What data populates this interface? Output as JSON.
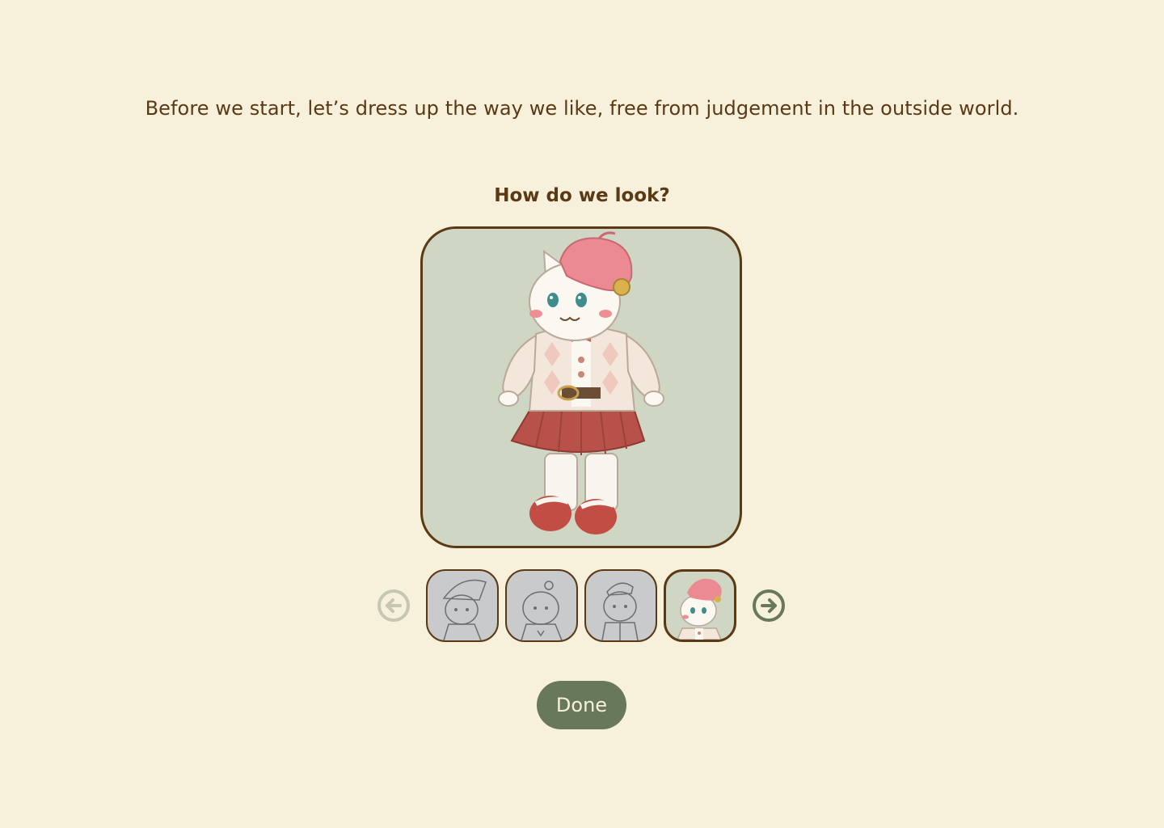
{
  "intro_text": "Before we start, let’s dress up the way we like, free from judgement in the outside world.",
  "question": "How do we look?",
  "done_label": "Done",
  "colors": {
    "background": "#f7f0db",
    "text": "#5a3915",
    "accent_green": "#67795a",
    "preview_bg": "#cfd6c3",
    "thumb_inactive_bg": "#c9cacb",
    "disabled_arrow": "#c5c7b3"
  },
  "carousel": {
    "prev_icon": "arrow-left-circle-icon",
    "next_icon": "arrow-right-circle-icon",
    "prev_enabled": false,
    "next_enabled": true,
    "outfits": [
      {
        "id": "outfit-1",
        "icon": "witch-hat-outfit",
        "selected": false
      },
      {
        "id": "outfit-2",
        "icon": "flower-outfit",
        "selected": false
      },
      {
        "id": "outfit-3",
        "icon": "cap-suit-outfit",
        "selected": false
      },
      {
        "id": "outfit-4",
        "icon": "beret-skirt-outfit",
        "selected": true
      }
    ]
  }
}
